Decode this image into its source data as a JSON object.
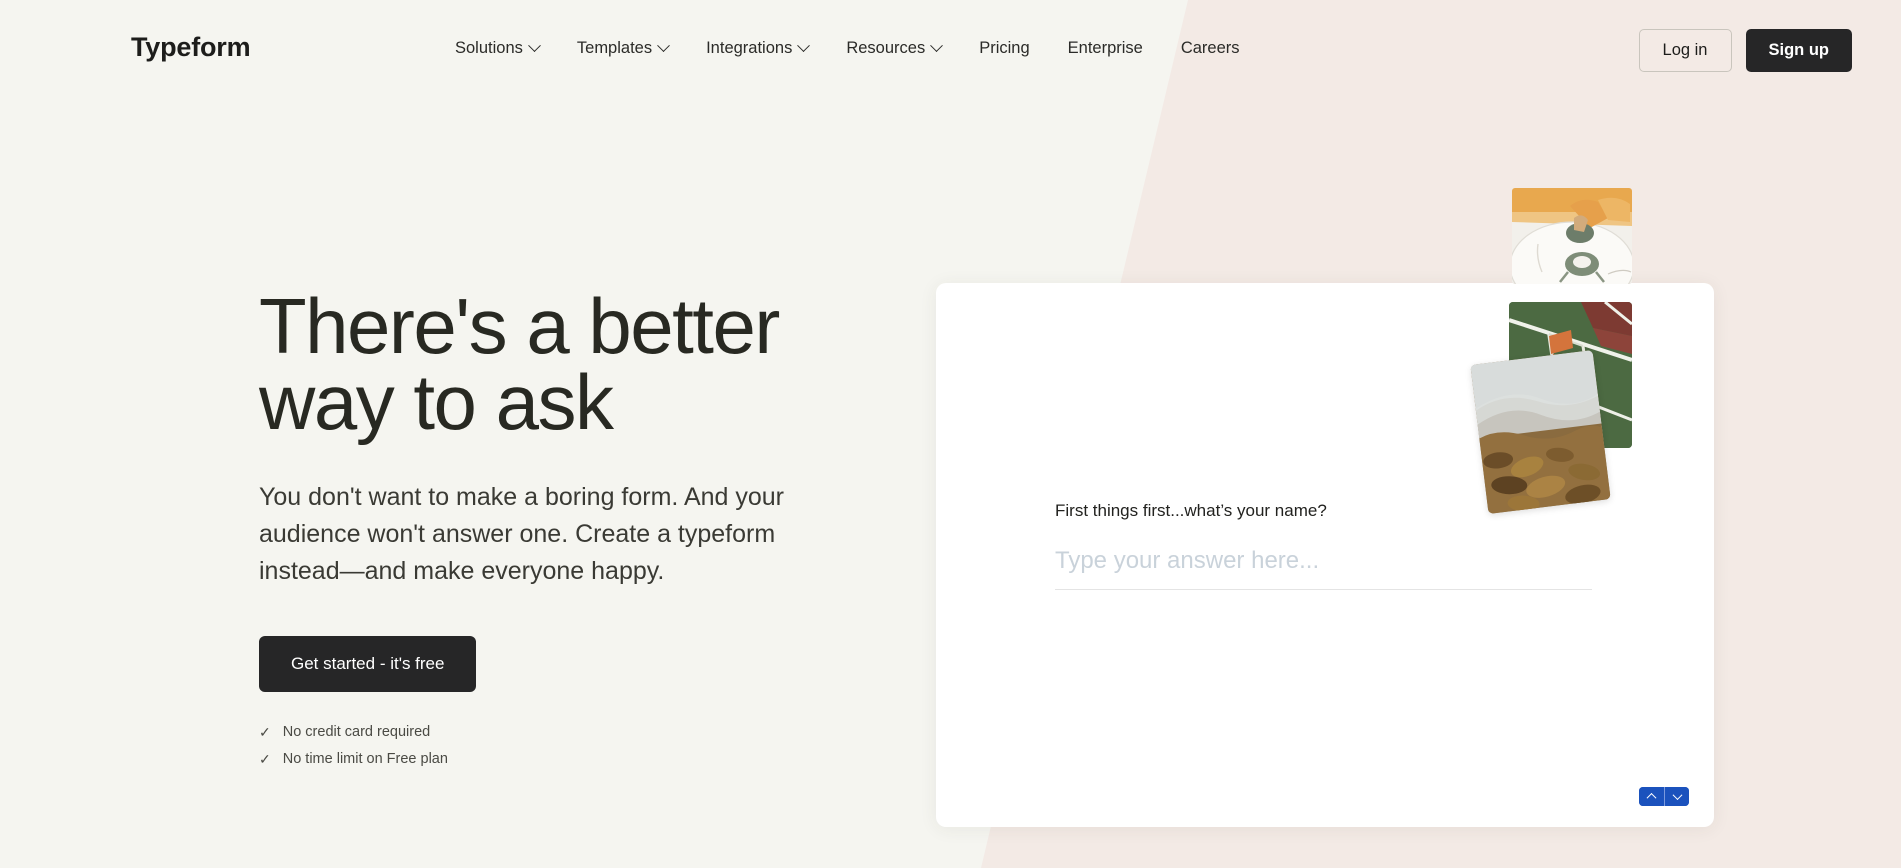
{
  "brand": {
    "name": "Typeform"
  },
  "nav": {
    "items": [
      {
        "label": "Solutions",
        "has_dropdown": true
      },
      {
        "label": "Templates",
        "has_dropdown": true
      },
      {
        "label": "Integrations",
        "has_dropdown": true
      },
      {
        "label": "Resources",
        "has_dropdown": true
      },
      {
        "label": "Pricing",
        "has_dropdown": false
      },
      {
        "label": "Enterprise",
        "has_dropdown": false
      },
      {
        "label": "Careers",
        "has_dropdown": false
      }
    ]
  },
  "auth": {
    "login_label": "Log in",
    "signup_label": "Sign up"
  },
  "hero": {
    "title_line1": "There's a better",
    "title_line2": "way to ask",
    "subtitle": "You don't want to make a boring form. And your audience won't answer one. Create a typeform instead—and make everyone happy.",
    "cta_label": "Get started - it's free",
    "perks": [
      {
        "tick": "✓",
        "label": "No credit card required"
      },
      {
        "tick": "✓",
        "label": "No time limit on Free plan"
      }
    ]
  },
  "form_card": {
    "question": "First things first...what’s your name?",
    "answer_value": "",
    "answer_placeholder": "Type your answer here...",
    "nav": {
      "up_icon": "chevron-up-icon",
      "down_icon": "chevron-down-icon"
    }
  },
  "collage": {
    "photos": [
      {
        "name": "photo-pottery-wheel"
      },
      {
        "name": "photo-tennis-court"
      },
      {
        "name": "photo-autumn-leaves"
      }
    ]
  },
  "colors": {
    "page_bg_left": "#F5F5F0",
    "page_bg_right": "#F3EAE5",
    "accent_dark": "#262627",
    "accent_blue": "#1B52BD",
    "text_primary": "#282922",
    "placeholder": "#C9D2DA"
  }
}
